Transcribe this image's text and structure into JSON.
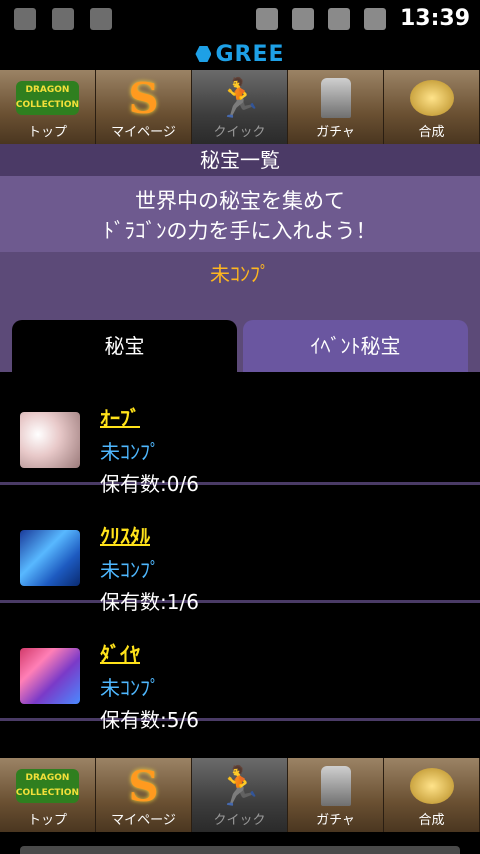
{
  "statusbar": {
    "time": "13:39"
  },
  "gree": {
    "logo_text": "GREE"
  },
  "nav_top": [
    {
      "label": "トップ",
      "icon": "dragon-collection-logo",
      "logo_line1": "DRAGON",
      "logo_line2": "COLLECTION"
    },
    {
      "label": "マイページ",
      "icon": "s-flame-icon"
    },
    {
      "label": "クイック",
      "icon": "runner-icon",
      "disabled": true
    },
    {
      "label": "ガチャ",
      "icon": "gacha-icon"
    },
    {
      "label": "合成",
      "icon": "gold-mascot-icon"
    }
  ],
  "nav_bottom": [
    {
      "label": "トップ",
      "logo_line1": "DRAGON",
      "logo_line2": "COLLECTION"
    },
    {
      "label": "マイページ"
    },
    {
      "label": "クイック",
      "disabled": true
    },
    {
      "label": "ガチャ"
    },
    {
      "label": "合成"
    }
  ],
  "page_title": "秘宝一覧",
  "description": {
    "line1": "世界中の秘宝を集めて",
    "line2": "ﾄﾞﾗｺﾞﾝの力を手に入れよう！"
  },
  "completion_status": "未ｺﾝﾌﾟ",
  "tabs": [
    {
      "label": "秘宝",
      "active": true
    },
    {
      "label": "ｲﾍﾞﾝﾄ秘宝",
      "active": false
    }
  ],
  "items": [
    {
      "name": "ｵｰﾌﾞ",
      "state": "未ｺﾝﾌﾟ",
      "count": "保有数:0/6"
    },
    {
      "name": "ｸﾘｽﾀﾙ",
      "state": "未ｺﾝﾌﾟ",
      "count": "保有数:1/6"
    },
    {
      "name": "ﾀﾞｲﾔ",
      "state": "未ｺﾝﾌﾟ",
      "count": "保有数:5/6"
    }
  ],
  "colors": {
    "accent_blue": "#1ea0e6",
    "gold": "#ffb71f",
    "item_name": "#ffe21a",
    "state_blue": "#4fb8ff",
    "purple_dark": "#4b3a66"
  }
}
